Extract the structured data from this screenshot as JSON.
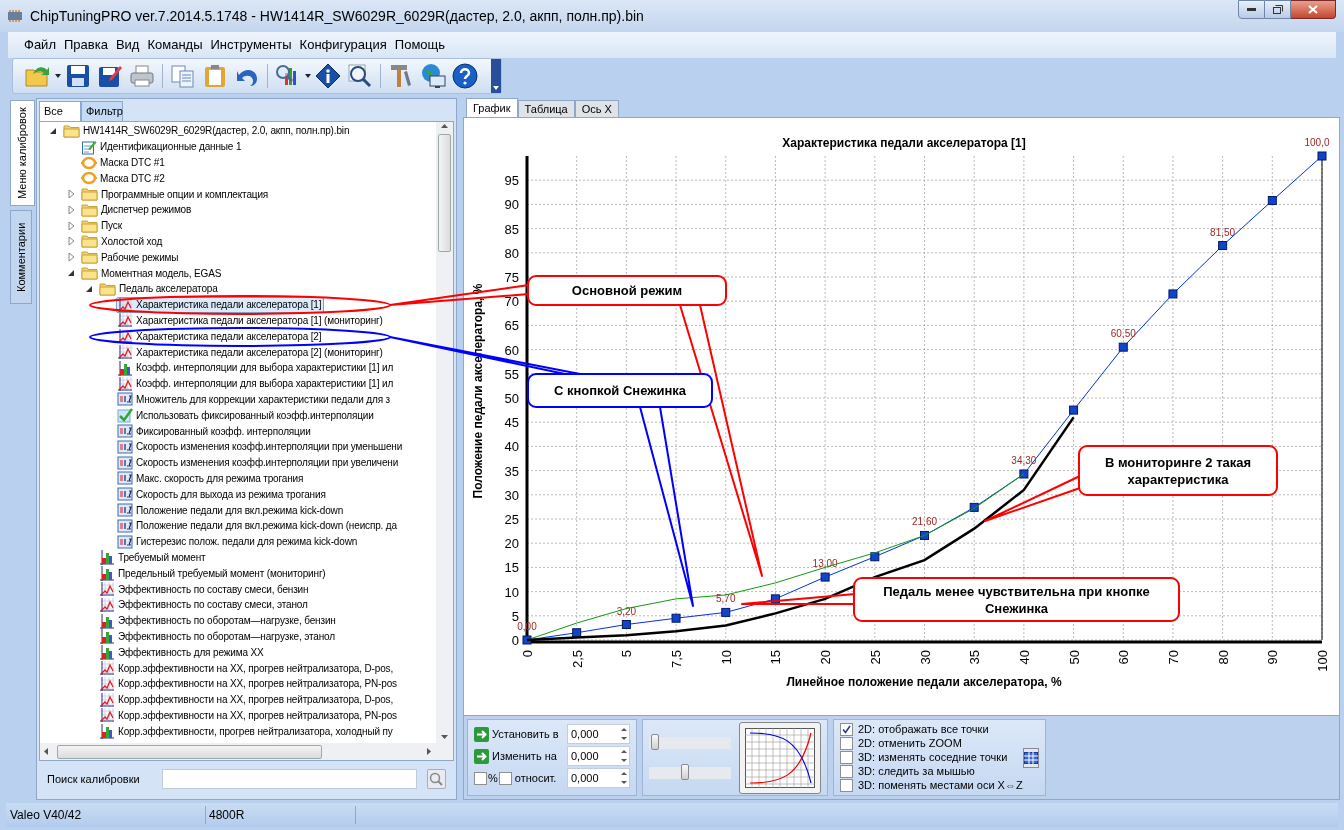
{
  "window": {
    "title": "ChipTuningPRO ver.7.2014.5.1748 - HW1414R_SW6029R_6029R(дастер, 2.0, акпп, полн.пр).bin"
  },
  "menu": [
    "Файл",
    "Правка",
    "Вид",
    "Команды",
    "Инструменты",
    "Конфигурация",
    "Помощь"
  ],
  "side_tabs": [
    {
      "label": "Меню калибровок",
      "selected": true
    },
    {
      "label": "Комментарии",
      "selected": false
    }
  ],
  "tree_tabs": [
    {
      "label": "Все",
      "selected": true
    },
    {
      "label": "Фильтр",
      "selected": false
    }
  ],
  "tree": [
    {
      "label": "HW1414R_SW6029R_6029R(дастер, 2.0, акпп, полн.пр).bin",
      "kind": "folder",
      "expanded": true,
      "selected": false,
      "children": [
        {
          "label": "Идентификационные данные 1",
          "kind": "doc",
          "selected": false
        },
        {
          "label": "Маска DTC #1",
          "kind": "mask",
          "selected": false
        },
        {
          "label": "Маска DTC #2",
          "kind": "mask",
          "selected": false
        },
        {
          "label": "Программные опции и комплектация",
          "kind": "folder",
          "expanded": false,
          "selected": false
        },
        {
          "label": "Диспетчер режимов",
          "kind": "folder",
          "expanded": false,
          "selected": false
        },
        {
          "label": "Пуск",
          "kind": "folder",
          "expanded": false,
          "selected": false
        },
        {
          "label": "Холостой ход",
          "kind": "folder",
          "expanded": false,
          "selected": false
        },
        {
          "label": "Рабочие режимы",
          "kind": "folder",
          "expanded": false,
          "selected": false
        },
        {
          "label": "Моментная модель, EGAS",
          "kind": "folder",
          "expanded": true,
          "selected": false,
          "children": [
            {
              "label": "Педаль акселератора",
              "kind": "folder",
              "expanded": true,
              "selected": false,
              "children": [
                {
                  "label": "Характеристика педали акселератора [1]",
                  "kind": "curve",
                  "selected": true
                },
                {
                  "label": "Характеристика педали акселератора [1] (мониторинг)",
                  "kind": "curve",
                  "selected": false
                },
                {
                  "label": "Характеристика педали акселератора [2]",
                  "kind": "curve",
                  "selected": false
                },
                {
                  "label": "Характеристика педали акселератора [2] (мониторинг)",
                  "kind": "curve",
                  "selected": false
                },
                {
                  "label": "Коэфф. интерполяции для выбора характеристики [1] ил",
                  "kind": "bars",
                  "selected": false
                },
                {
                  "label": "Коэфф. интерполяции для выбора характеристики [1] ил",
                  "kind": "curve",
                  "selected": false
                },
                {
                  "label": "Множитель для коррекции характеристики педали для з",
                  "kind": "number",
                  "selected": false
                },
                {
                  "label": "Использовать фиксированный коэфф.интерполяции",
                  "kind": "check",
                  "selected": false
                },
                {
                  "label": "Фиксированный коэфф. интерполяции",
                  "kind": "number",
                  "selected": false
                },
                {
                  "label": "Скорость изменения коэфф.интерполяции при уменьшени",
                  "kind": "number",
                  "selected": false
                },
                {
                  "label": "Скорость изменения коэфф.интерполяции при увеличени",
                  "kind": "number",
                  "selected": false
                },
                {
                  "label": "Макс. скорость для режима трогания",
                  "kind": "number",
                  "selected": false
                },
                {
                  "label": "Скорость для выхода из режима трогания",
                  "kind": "number",
                  "selected": false
                },
                {
                  "label": "Положение педали для вкл.режима kick-down",
                  "kind": "number",
                  "selected": false
                },
                {
                  "label": "Положение педали для вкл.режима kick-down (неиспр. да",
                  "kind": "number",
                  "selected": false
                },
                {
                  "label": "Гистерезис полож. педали для режима kick-down",
                  "kind": "number",
                  "selected": false
                }
              ]
            },
            {
              "label": "Требуемый момент",
              "kind": "bars",
              "selected": false
            },
            {
              "label": "Предельный требуемый момент (мониторинг)",
              "kind": "bars",
              "selected": false
            },
            {
              "label": "Эффективность по составу смеси, бензин",
              "kind": "curve",
              "selected": false
            },
            {
              "label": "Эффективность по составу смеси, этанол",
              "kind": "curve",
              "selected": false
            },
            {
              "label": "Эффективность по оборотам—нагрузке, бензин",
              "kind": "bars",
              "selected": false
            },
            {
              "label": "Эффективность по оборотам—нагрузке, этанол",
              "kind": "bars",
              "selected": false
            },
            {
              "label": "Эффективность для режима XX",
              "kind": "bars",
              "selected": false
            },
            {
              "label": "Корр.эффективности на XX, прогрев нейтрализатора, D-pos,",
              "kind": "curve",
              "selected": false
            },
            {
              "label": "Корр.эффективности на XX, прогрев нейтрализатора, PN-pos",
              "kind": "curve",
              "selected": false
            },
            {
              "label": "Корр.эффективности на XX, прогрев нейтрализатора, D-pos,",
              "kind": "curve",
              "selected": false
            },
            {
              "label": "Корр.эффективности на XX, прогрев нейтрализатора, PN-pos",
              "kind": "curve",
              "selected": false
            },
            {
              "label": "Корр.эффективности, прогрев нейтрализатора, холодный пу",
              "kind": "bars",
              "selected": false
            }
          ]
        }
      ]
    }
  ],
  "search": {
    "label": "Поиск калибровки"
  },
  "chart_tabs": [
    {
      "label": "График",
      "selected": true
    },
    {
      "label": "Таблица",
      "selected": false
    },
    {
      "label": "Ось X",
      "selected": false
    }
  ],
  "chart": {
    "chart_data": {
      "type": "line",
      "title": "Характеристика педали акселератора [1]",
      "xlabel": "Линейное положение педали акселератора, %",
      "ylabel": "Положение педали акселератора, %",
      "categories": [
        "0",
        "2,5",
        "5",
        "7,5",
        "10",
        "15",
        "20",
        "25",
        "30",
        "35",
        "40",
        "50",
        "60",
        "70",
        "80",
        "90",
        "100"
      ],
      "ylim": [
        0,
        100
      ],
      "grid": true,
      "yticks": [
        0,
        5,
        10,
        15,
        20,
        25,
        30,
        35,
        40,
        45,
        50,
        55,
        60,
        65,
        70,
        75,
        80,
        85,
        90,
        95
      ],
      "series": [
        {
          "marker": true,
          "color": "#0033dd",
          "values": [
            0,
            1.5,
            3.2,
            4.5,
            5.7,
            8.5,
            13,
            17.2,
            21.6,
            27.4,
            34.3,
            47.5,
            60.5,
            71.5,
            81.5,
            90.8,
            100
          ],
          "value_labels": [
            "0,00",
            null,
            "3,20",
            null,
            "5,70",
            null,
            "13,00",
            null,
            "21,60",
            null,
            "34,30",
            null,
            "60,50",
            null,
            "81,50",
            null,
            "100,0"
          ]
        },
        {
          "marker": false,
          "color": "#119911",
          "values": [
            0,
            3.5,
            6.5,
            8.5,
            9.3,
            11.8,
            15,
            18,
            21.6,
            27.2,
            34.3,
            null,
            null,
            null,
            null,
            null,
            null
          ]
        },
        {
          "marker": false,
          "color": "#000000",
          "values": [
            0,
            0.5,
            1,
            1.8,
            3,
            5.5,
            8.5,
            13,
            16.5,
            23,
            31,
            46,
            null,
            null,
            null,
            null,
            null
          ]
        }
      ]
    }
  },
  "callouts": [
    {
      "text": "Основной режим",
      "color": "#ff0000"
    },
    {
      "text": "С кнопкой Снежинка",
      "color": "#0000ff"
    },
    {
      "text": "В мониторинге 2 такая характеристика",
      "color": "#ff0000"
    },
    {
      "text": "Педаль менее чувствительна при кнопке Снежинка",
      "color": "#ff0000"
    }
  ],
  "edit_panel": {
    "rows": [
      {
        "label": "Установить в",
        "value": "0,000"
      },
      {
        "label": "Изменить на",
        "value": "0,000"
      }
    ],
    "percent": {
      "label": "%",
      "checked": false
    },
    "relative": {
      "label": "относит.",
      "checked": false
    },
    "third_value": "0,000"
  },
  "sliders": [
    {
      "level": 0.03
    },
    {
      "level": 0.43
    }
  ],
  "options": [
    {
      "label": "2D: отображать все точки",
      "checked": true
    },
    {
      "label": "2D: отменить ZOOM",
      "checked": false
    },
    {
      "label": "3D: изменять соседние точки",
      "checked": false
    },
    {
      "label": "3D: следить за мышью",
      "checked": false
    },
    {
      "label": "3D: поменять местами оси X⇔Z",
      "checked": false
    }
  ],
  "status_bar": [
    "Valeo V40/42",
    "4800R"
  ]
}
